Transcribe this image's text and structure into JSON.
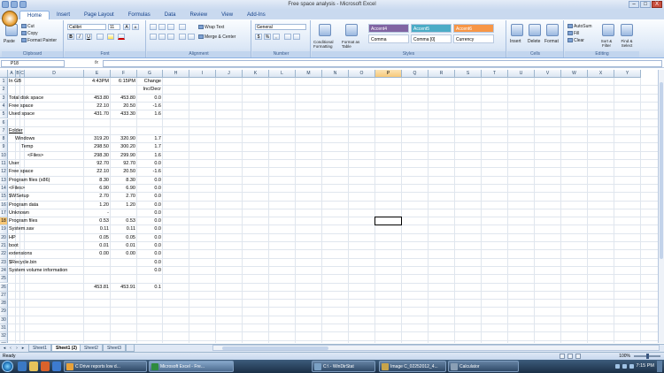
{
  "window": {
    "title": "Free space analysis - Microsoft Excel",
    "minimize": "–",
    "restore": "□",
    "close": "X"
  },
  "ribbon_tabs": [
    "Home",
    "Insert",
    "Page Layout",
    "Formulas",
    "Data",
    "Review",
    "View",
    "Add-Ins"
  ],
  "ribbon": {
    "clipboard": {
      "label": "Clipboard",
      "paste": "Paste",
      "cut": "Cut",
      "copy": "Copy",
      "format_painter": "Format Painter"
    },
    "font": {
      "label": "Font",
      "font_name": "Calibri",
      "font_size": "11",
      "bold": "B",
      "italic": "I",
      "underline": "U",
      "grow": "A",
      "shrink": "A"
    },
    "alignment": {
      "label": "Alignment",
      "wrap_text": "Wrap Text",
      "merge_center": "Merge & Center"
    },
    "number": {
      "label": "Number",
      "format": "General",
      "currency": "$",
      "percent": "%",
      "comma": ","
    },
    "styles": {
      "label": "Styles",
      "conditional": "Conditional Formatting",
      "format_table": "Format as Table",
      "cells": [
        {
          "text": "Accent4",
          "color": "#8064a2",
          "fg": "#ffffff"
        },
        {
          "text": "Accent5",
          "color": "#4bacc6",
          "fg": "#ffffff"
        },
        {
          "text": "Accent6",
          "color": "#f79646",
          "fg": "#ffffff"
        },
        {
          "text": "Comma",
          "color": "#ffffff",
          "fg": "#000000"
        },
        {
          "text": "Comma [0]",
          "color": "#ffffff",
          "fg": "#000000"
        },
        {
          "text": "Currency",
          "color": "#ffffff",
          "fg": "#000000"
        }
      ]
    },
    "cells": {
      "label": "Cells",
      "insert": "Insert",
      "delete": "Delete",
      "format": "Format"
    },
    "editing": {
      "label": "Editing",
      "autosum": "AutoSum",
      "fill": "Fill",
      "clear": "Clear",
      "sort_filter": "Sort & Filter",
      "find_select": "Find & Select"
    }
  },
  "formula_bar": {
    "name_box": "P18",
    "fx": "fx",
    "formula": ""
  },
  "columns": [
    "A",
    "B",
    "C",
    "D",
    "E",
    "F",
    "G",
    "H",
    "I",
    "J",
    "K",
    "L",
    "M",
    "N",
    "O",
    "P",
    "Q",
    "R",
    "S",
    "T",
    "U",
    "V",
    "W",
    "X",
    "Y"
  ],
  "selected_column": "P",
  "selected_row": 18,
  "rows": [
    {
      "n": 1,
      "label": "In GB",
      "e": "4:43PM",
      "f": "6:15PM",
      "g": "Change"
    },
    {
      "n": 2,
      "label": "",
      "e": "",
      "f": "",
      "g": "Inc/Decr"
    },
    {
      "n": 3,
      "label": "Total disk space",
      "e": "453.80",
      "f": "453.80",
      "g": "0.0"
    },
    {
      "n": 4,
      "label": "Free space",
      "e": "22.10",
      "f": "20.50",
      "g": "-1.6"
    },
    {
      "n": 5,
      "label": "Used space",
      "e": "431.70",
      "f": "433.30",
      "g": "1.6"
    },
    {
      "n": 6,
      "label": "",
      "e": "",
      "f": "",
      "g": ""
    },
    {
      "n": 7,
      "label": "Folder",
      "e": "",
      "f": "",
      "g": "",
      "underline": true
    },
    {
      "n": 8,
      "label": "Windows",
      "indent": 1,
      "e": "319.20",
      "f": "320.90",
      "g": "1.7"
    },
    {
      "n": 9,
      "label": "Temp",
      "indent": 2,
      "e": "298.50",
      "f": "300.20",
      "g": "1.7"
    },
    {
      "n": 10,
      "label": "<Files>",
      "indent": 3,
      "e": "298.30",
      "f": "299.90",
      "g": "1.6"
    },
    {
      "n": 11,
      "label": "User",
      "e": "92.70",
      "f": "92.70",
      "g": "0.0"
    },
    {
      "n": 12,
      "label": "Free space",
      "e": "22.10",
      "f": "20.50",
      "g": "-1.6"
    },
    {
      "n": 13,
      "label": "Program files (x86)",
      "e": "8.30",
      "f": "8.30",
      "g": "0.0"
    },
    {
      "n": 14,
      "label": "<Files>",
      "e": "6.90",
      "f": "6.90",
      "g": "0.0"
    },
    {
      "n": 15,
      "label": "$WSetup",
      "e": "2.70",
      "f": "2.70",
      "g": "0.0"
    },
    {
      "n": 16,
      "label": "Program data",
      "e": "1.20",
      "f": "1.20",
      "g": "0.0"
    },
    {
      "n": 17,
      "label": "Unknown",
      "e": "-",
      "f": "",
      "g": "0.0"
    },
    {
      "n": 18,
      "label": "Program files",
      "e": "0.53",
      "f": "0.53",
      "g": "0.0"
    },
    {
      "n": 19,
      "label": "System.sav",
      "e": "0.11",
      "f": "0.11",
      "g": "0.0"
    },
    {
      "n": 20,
      "label": "HP",
      "e": "0.05",
      "f": "0.05",
      "g": "0.0"
    },
    {
      "n": 21,
      "label": "boot",
      "e": "0.01",
      "f": "0.01",
      "g": "0.0"
    },
    {
      "n": 22,
      "label": "extensions",
      "e": "0.00",
      "f": "0.00",
      "g": "0.0"
    },
    {
      "n": 23,
      "label": "$Recycle.bin",
      "e": "",
      "f": "",
      "g": "0.0"
    },
    {
      "n": 24,
      "label": "System volume information",
      "e": "",
      "f": "",
      "g": "0.0"
    },
    {
      "n": 25,
      "label": "",
      "e": "",
      "f": "",
      "g": ""
    },
    {
      "n": 26,
      "label": "",
      "e": "453.81",
      "f": "453.91",
      "g": "0.1"
    },
    {
      "n": 27,
      "label": "",
      "e": "",
      "f": "",
      "g": ""
    },
    {
      "n": 28,
      "label": "",
      "e": "",
      "f": "",
      "g": ""
    },
    {
      "n": 29,
      "label": "",
      "e": "",
      "f": "",
      "g": ""
    },
    {
      "n": 30,
      "label": "",
      "e": "",
      "f": "",
      "g": ""
    },
    {
      "n": 31,
      "label": "",
      "e": "",
      "f": "",
      "g": ""
    },
    {
      "n": 32,
      "label": "",
      "e": "",
      "f": "",
      "g": ""
    },
    {
      "n": 33,
      "label": "",
      "e": "",
      "f": "",
      "g": ""
    }
  ],
  "sheet_tabs": [
    {
      "name": "Sheet1",
      "active": false
    },
    {
      "name": "Sheet1 (2)",
      "active": true
    },
    {
      "name": "Sheet2",
      "active": false
    },
    {
      "name": "Sheet3",
      "active": false
    }
  ],
  "status": {
    "ready": "Ready",
    "zoom": "100%"
  },
  "taskbar": {
    "items": [
      {
        "label": "C Drive reports low d...",
        "color": "#e8a23a",
        "active": false
      },
      {
        "label": "Microsoft Excel - Fre...",
        "color": "#2e8b3e",
        "active": true
      },
      {
        "label": "C:\\ - WinDirStat",
        "color": "#7aa0c4",
        "active": false
      },
      {
        "label": "Image C_02252012_4...",
        "color": "#c7a44a",
        "active": false
      },
      {
        "label": "Calculator",
        "color": "#8a9fb5",
        "active": false
      }
    ],
    "clock": "7:15 PM"
  }
}
